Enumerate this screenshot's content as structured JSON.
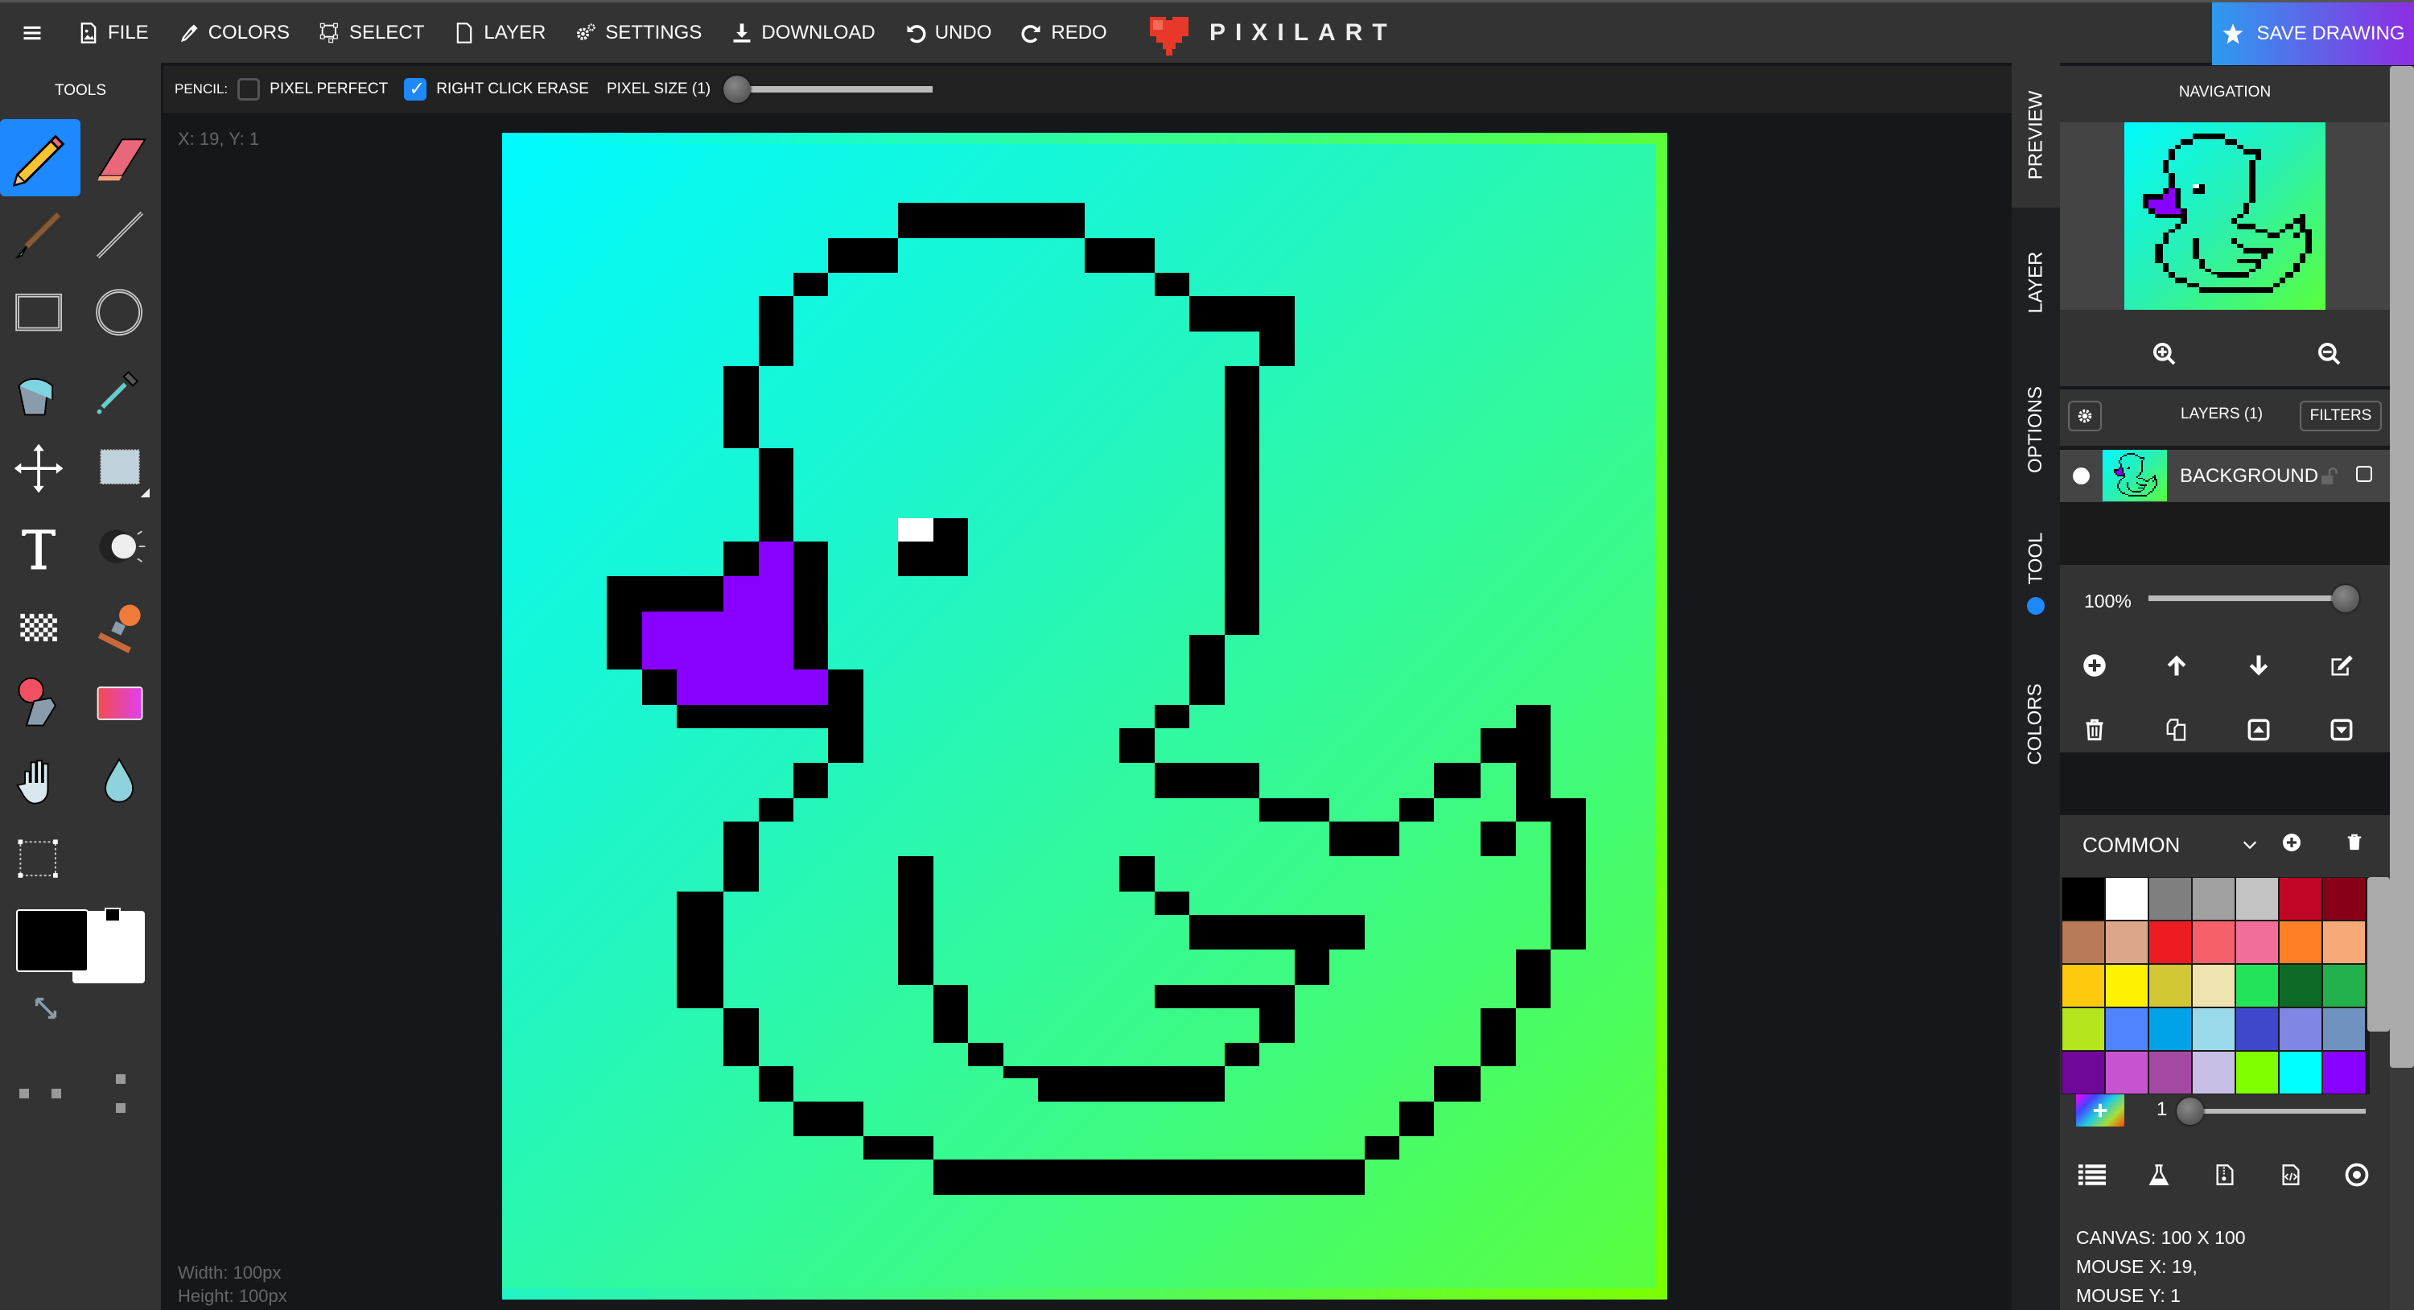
{
  "app": {
    "name": "PIXILART"
  },
  "menu": [
    {
      "id": "file",
      "label": "FILE",
      "icon": "file-image-icon"
    },
    {
      "id": "colors",
      "label": "COLORS",
      "icon": "eyedropper-icon"
    },
    {
      "id": "select",
      "label": "SELECT",
      "icon": "select-icon"
    },
    {
      "id": "layer",
      "label": "LAYER",
      "icon": "layer-file-icon"
    },
    {
      "id": "settings",
      "label": "SETTINGS",
      "icon": "gears-icon"
    },
    {
      "id": "download",
      "label": "DOWNLOAD",
      "icon": "download-icon"
    },
    {
      "id": "undo",
      "label": "UNDO",
      "icon": "undo-icon"
    },
    {
      "id": "redo",
      "label": "REDO",
      "icon": "redo-icon"
    }
  ],
  "save_button": "SAVE DRAWING",
  "tools_title": "TOOLS",
  "tools": [
    "pencil",
    "eraser",
    "brush",
    "line",
    "rectangle",
    "circle",
    "bucket",
    "eyedropper",
    "move",
    "select-shape",
    "text",
    "lighten-darken",
    "dither",
    "stamp",
    "spray",
    "gradient",
    "hand",
    "blur",
    "crop"
  ],
  "active_tool": "pencil",
  "options": {
    "tool_label": "PENCIL:",
    "pixel_perfect": {
      "label": "PIXEL PERFECT",
      "checked": false
    },
    "right_click_erase": {
      "label": "RIGHT CLICK ERASE",
      "checked": true
    },
    "pixel_size": {
      "label": "PIXEL SIZE (1)",
      "value": 1,
      "min": 1,
      "max": 100
    }
  },
  "canvas_overlay": {
    "coords": "X: 19, Y: 1",
    "width": "Width: 100px",
    "height": "Height: 100px"
  },
  "colors": {
    "primary": "#000000",
    "secondary": "#ffffff",
    "accent": "#1e88ff",
    "beak": "#8800ff"
  },
  "side_tabs": [
    "PREVIEW",
    "LAYER",
    "OPTIONS",
    "TOOL",
    "COLORS"
  ],
  "navigation": {
    "title": "NAVIGATION"
  },
  "layers": {
    "title": "LAYERS (1)",
    "filters_label": "FILTERS",
    "items": [
      {
        "name": "BACKGROUND",
        "visible": true,
        "locked": false
      }
    ],
    "opacity": "100%",
    "opacity_value": 100
  },
  "palette": {
    "name": "COMMON",
    "swatches": [
      "#000000",
      "#ffffff",
      "#7f7f7f",
      "#a0a0a0",
      "#c3c3c3",
      "#c00526",
      "#880018",
      "#b97a57",
      "#dba68a",
      "#ed1c24",
      "#f6606a",
      "#f06e99",
      "#ff7f27",
      "#f7aa78",
      "#ffc90e",
      "#fff200",
      "#d1c633",
      "#efe4b0",
      "#22e45a",
      "#0e6b27",
      "#23b14d",
      "#b5e61d",
      "#5083ff",
      "#00a2e8",
      "#99d9ea",
      "#3f48cc",
      "#7f86e4",
      "#7092be",
      "#700899",
      "#c853d0",
      "#a349a4",
      "#c8bfe7",
      "#7fff00",
      "#00ffff",
      "#8800ff"
    ],
    "brush_size": "1",
    "brush_size_value": 1
  },
  "info": {
    "canvas": "CANVAS: 100 X 100",
    "mouse_x": "MOUSE X: 19,",
    "mouse_y": "MOUSE Y: 1"
  }
}
